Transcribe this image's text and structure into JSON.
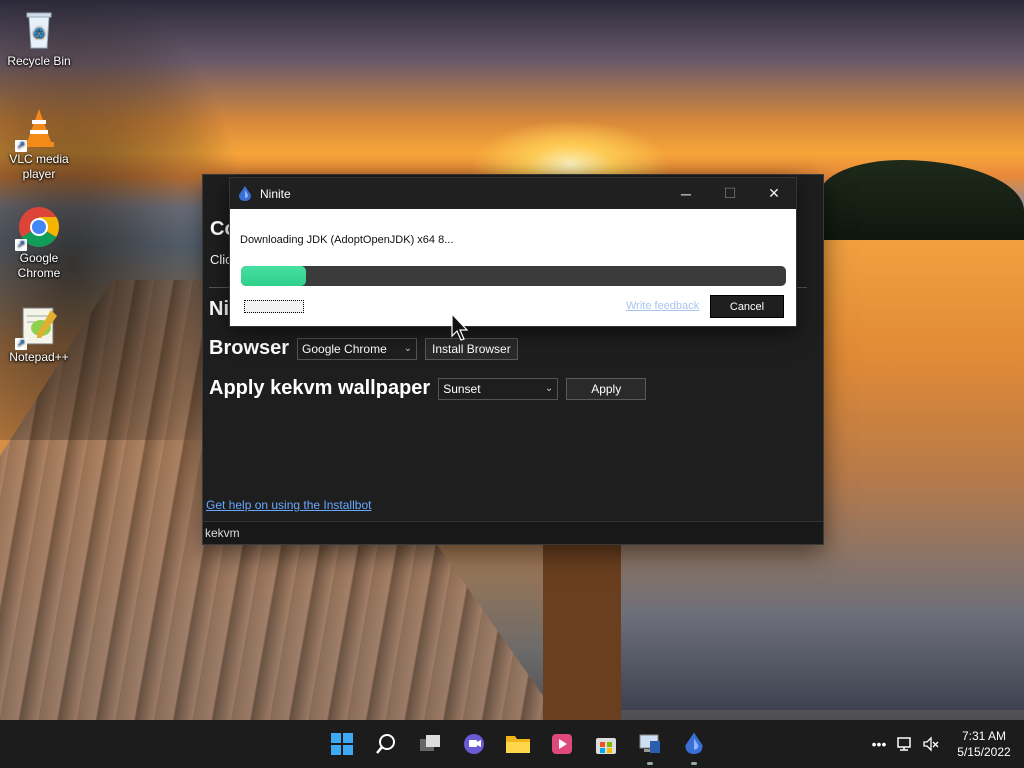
{
  "desktop": {
    "icons": [
      {
        "label": "Recycle Bin",
        "icon": "recycle-bin-icon"
      },
      {
        "label": "VLC media player",
        "icon": "vlc-icon"
      },
      {
        "label": "Google Chrome",
        "icon": "chrome-icon"
      },
      {
        "label": "Notepad++",
        "icon": "notepad-plus-plus-icon"
      }
    ]
  },
  "installbot": {
    "heading_frag_1": "Co",
    "subtext_frag": "Clic",
    "heading_frag_2": "Ni",
    "browser_label": "Browser",
    "browser_select_value": "Google Chrome",
    "install_browser_button": "Install Browser",
    "wallpaper_label": "Apply kekvm wallpaper",
    "wallpaper_select_value": "Sunset",
    "apply_button": "Apply",
    "help_link": "Get help on using the Installbot",
    "status_text": "kekvm"
  },
  "ninite": {
    "title": "Ninite",
    "downloading_text": "Downloading JDK (AdoptOpenJDK) x64 8...",
    "progress_fraction": 0.12,
    "feedback_link": "Write feedback",
    "cancel_button": "Cancel",
    "accent_color": "#3ddc96"
  },
  "taskbar": {
    "apps": [
      "start-icon",
      "search-icon",
      "task-view-icon",
      "chat-icon",
      "file-explorer-icon",
      "media-player-icon",
      "store-icon",
      "installbot-icon",
      "ninite-icon"
    ],
    "tray": [
      "overflow-icon",
      "network-icon",
      "volume-muted-icon"
    ],
    "time": "7:31 AM",
    "date": "5/15/2022"
  }
}
